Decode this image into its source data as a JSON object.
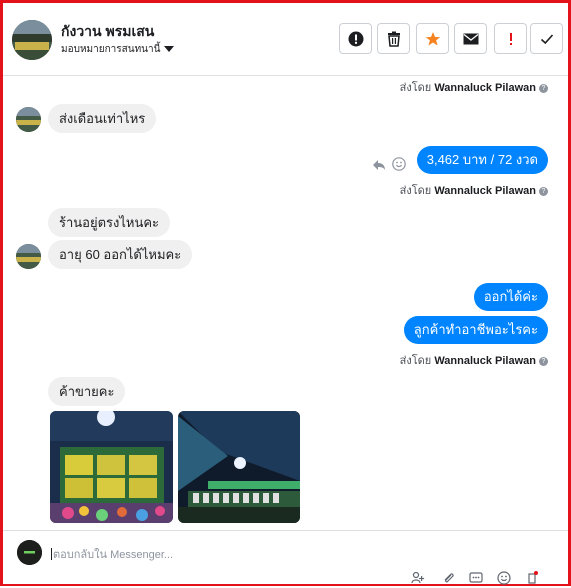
{
  "header": {
    "contact_name": "กังวาน พรมเสน",
    "assign_label": "มอบหมายการสนทนานี้",
    "actions": [
      {
        "name": "report-spam-button",
        "glyph": "!"
      },
      {
        "name": "delete-button",
        "glyph": "🗑"
      },
      {
        "name": "star-button",
        "glyph": "★"
      },
      {
        "name": "mark-unread-button",
        "glyph": "✉"
      },
      {
        "name": "important-button",
        "glyph": "!"
      },
      {
        "name": "mark-done-button",
        "glyph": "✓"
      }
    ]
  },
  "sent_by": {
    "prefix": "ส่งโดย",
    "name": "Wannaluck Pilawan",
    "info_glyph": "?"
  },
  "messages": {
    "m1": "ส่งเดือนเท่าไหร",
    "m2": "3,462 บาท   / 72 งวด",
    "m3": "ร้านอยู่ตรงไหนคะ",
    "m4": "อายุ 60 ออกได้ไหมคะ",
    "m5": "ออกได้ค่ะ",
    "m6": "ลูกค้าทำอาชีพอะไรคะ",
    "m7": "ค้าขายคะ"
  },
  "message_actions": {
    "reply_icon": "reply-icon",
    "emoji_icon": "emoji-icon"
  },
  "composer": {
    "placeholder": "ตอบกลับใน Messenger..."
  },
  "colors": {
    "frame": "#e3121b",
    "outgoing": "#0084ff",
    "incoming": "#f1f0f0",
    "star": "#f5821f",
    "important": "#e3121b"
  }
}
